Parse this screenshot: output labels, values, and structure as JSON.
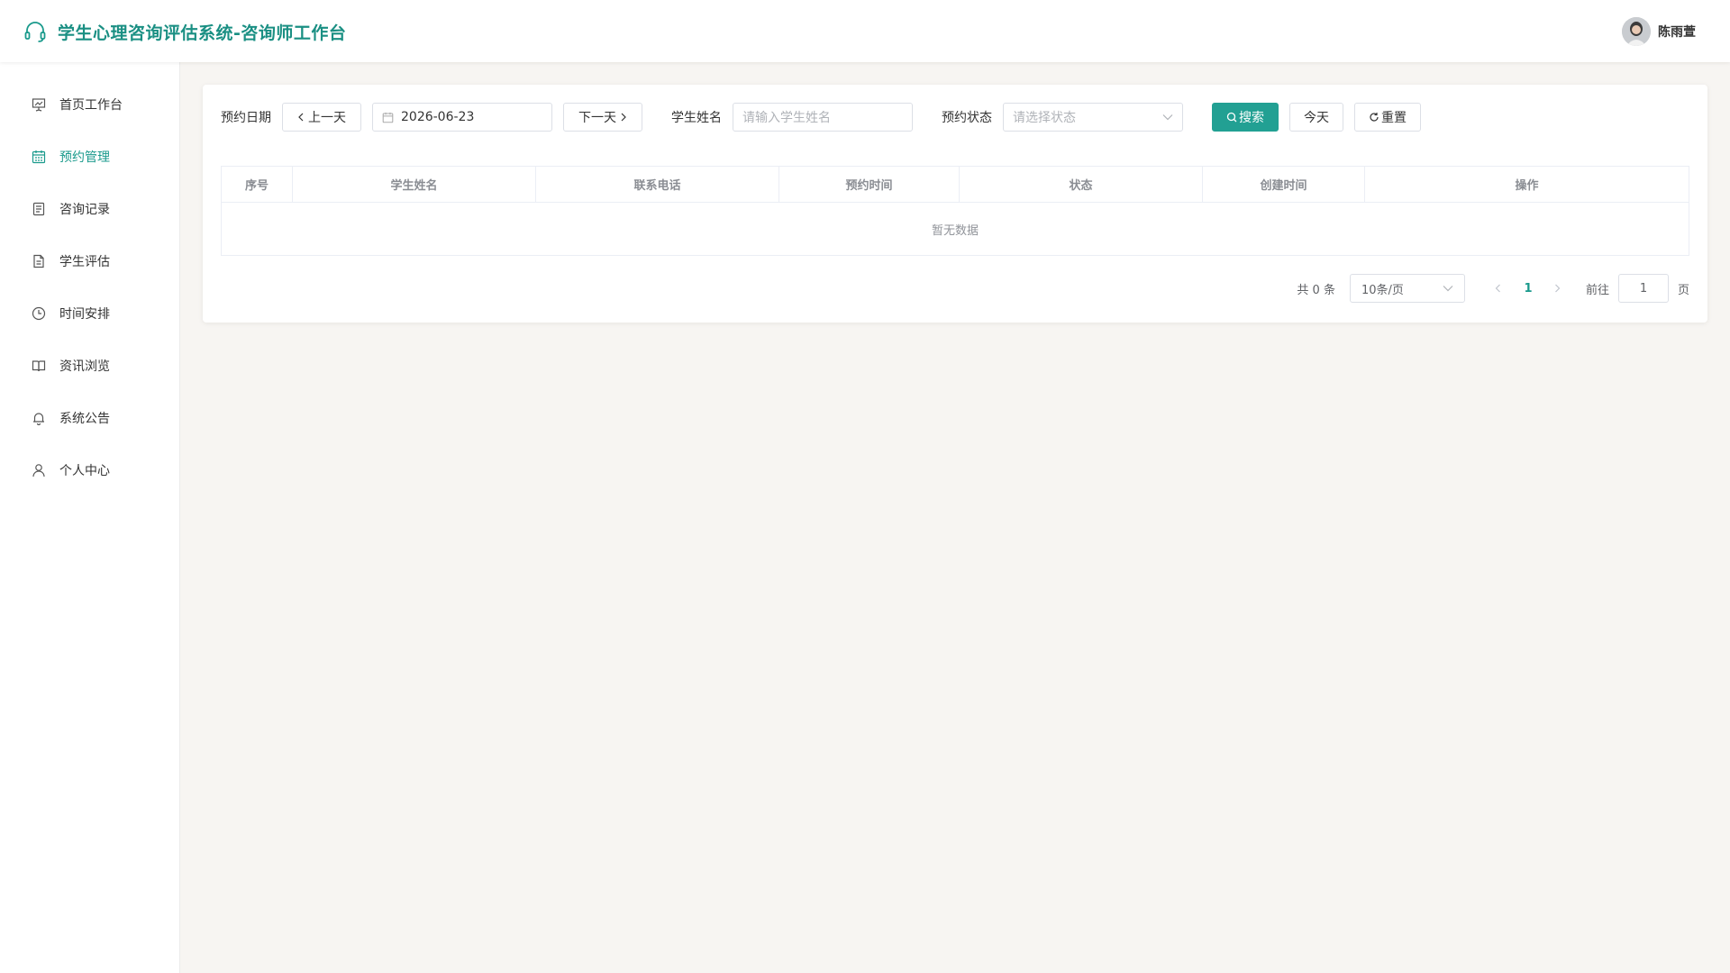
{
  "header": {
    "title": "学生心理咨询评估系统-咨询师工作台",
    "user_name": "陈雨萱"
  },
  "sidebar": {
    "items": [
      {
        "label": "首页工作台",
        "icon": "presentation-icon"
      },
      {
        "label": "预约管理",
        "icon": "calendar-icon"
      },
      {
        "label": "咨询记录",
        "icon": "record-icon"
      },
      {
        "label": "学生评估",
        "icon": "document-icon"
      },
      {
        "label": "时间安排",
        "icon": "clock-icon"
      },
      {
        "label": "资讯浏览",
        "icon": "book-icon"
      },
      {
        "label": "系统公告",
        "icon": "bell-icon"
      },
      {
        "label": "个人中心",
        "icon": "user-icon"
      }
    ]
  },
  "filter": {
    "date_label": "预约日期",
    "prev_day": "上一天",
    "date_value": "2026-06-23",
    "next_day": "下一天",
    "student_label": "学生姓名",
    "student_placeholder": "请输入学生姓名",
    "status_label": "预约状态",
    "status_placeholder": "请选择状态",
    "search": "搜索",
    "today": "今天",
    "reset": "重置"
  },
  "table": {
    "columns": [
      "序号",
      "学生姓名",
      "联系电话",
      "预约时间",
      "状态",
      "创建时间",
      "操作"
    ],
    "empty_text": "暂无数据"
  },
  "pagination": {
    "total_text": "共 0 条",
    "page_size": "10条/页",
    "current_page": "1",
    "goto_label": "前往",
    "goto_value": "1",
    "page_suffix": "页"
  },
  "colors": {
    "accent": "#22a093",
    "brand_text": "#1a8f83",
    "background": "#f7f5f2"
  }
}
